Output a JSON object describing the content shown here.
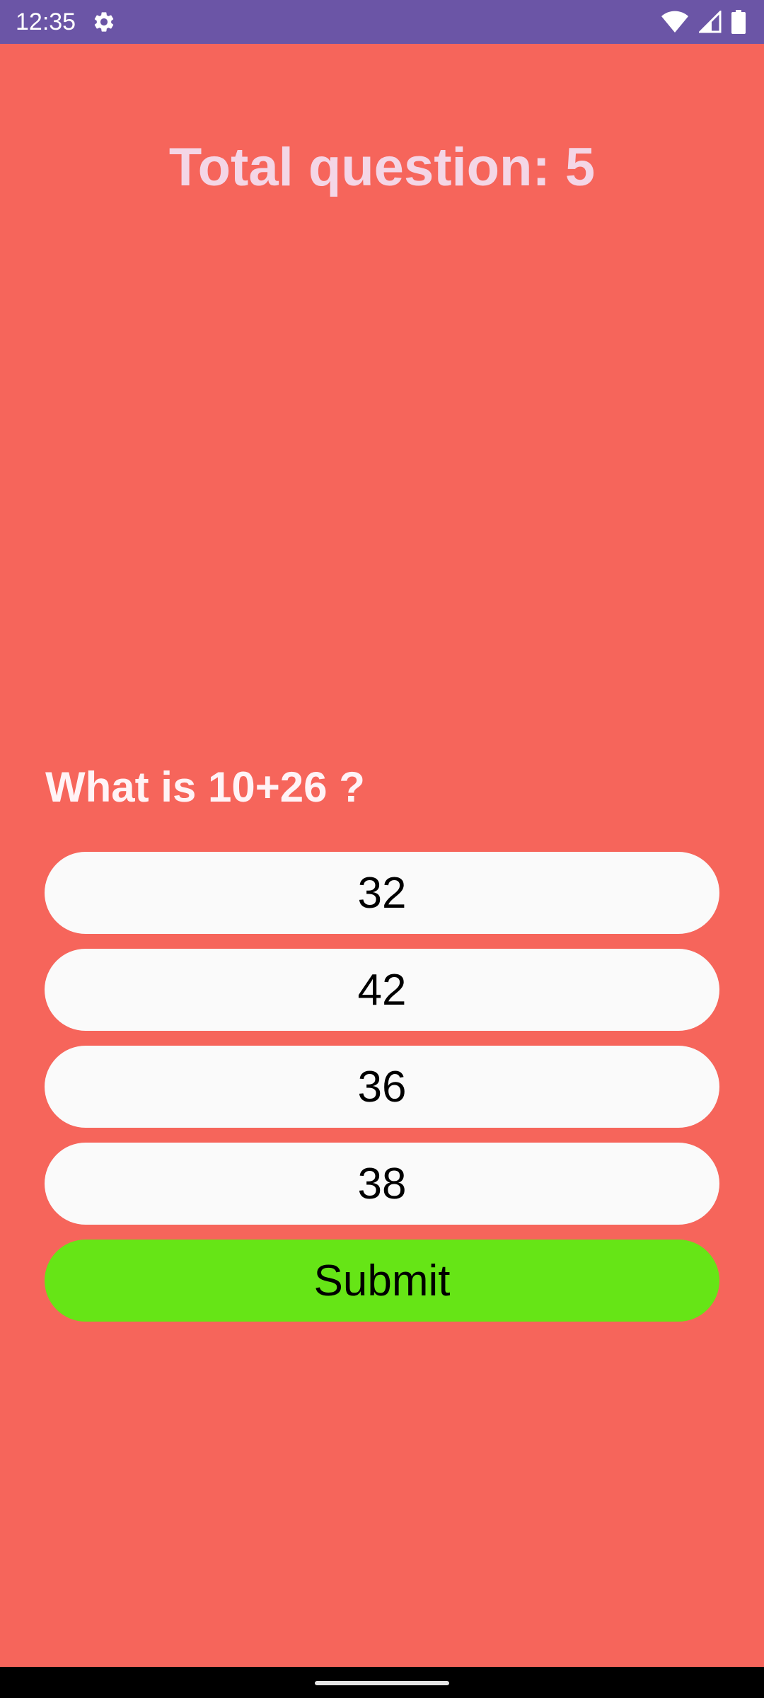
{
  "status_bar": {
    "time": "12:35",
    "icons": [
      "settings-gear-icon",
      "wifi-icon",
      "cell-signal-icon",
      "battery-icon"
    ],
    "background": "#6B55A6"
  },
  "quiz": {
    "total_label": "Total question: 5",
    "question": "What is 10+26 ?",
    "options": [
      "32",
      "42",
      "36",
      "38"
    ],
    "submit_label": "Submit"
  },
  "colors": {
    "background": "#F6655B",
    "title_text": "#F4D6E6",
    "option_bg": "#FAFAFA",
    "submit_bg": "#66E516"
  }
}
